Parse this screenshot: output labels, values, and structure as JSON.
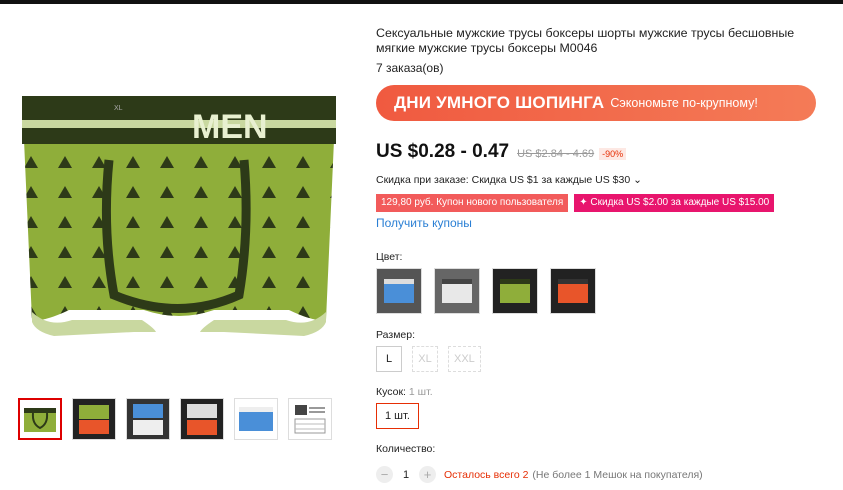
{
  "product": {
    "title": "Сексуальные мужские трусы боксеры шорты мужские трусы бесшовные мягкие мужские трусы боксеры M0046",
    "orders": "7 заказа(ов)"
  },
  "promo": {
    "main": "ДНИ УМНОГО ШОПИНГА",
    "sub": "Сэкономьте по-крупному!"
  },
  "pricing": {
    "price": "US $0.28 - 0.47",
    "old_price": "US $2.84 - 4.69",
    "discount": "-90%"
  },
  "store_discount": "Скидка при заказе: Скидка US $1 за каждые US $30 ⌄",
  "coupons": [
    "129,80 руб. Купон нового пользователя",
    "✦ Скидка US $2.00 за каждые US $15.00"
  ],
  "get_coupons": "Получить купоны",
  "color": {
    "label": "Цвет:",
    "options": [
      "blue",
      "white",
      "green",
      "orange"
    ]
  },
  "size": {
    "label": "Размер:",
    "options": [
      "L",
      "XL",
      "XXL"
    ]
  },
  "pieces": {
    "label": "Кусок:",
    "value": "1 шт.",
    "option": "1 шт."
  },
  "quantity": {
    "label": "Количество:",
    "value": "1",
    "minus_icon": "minus-icon",
    "plus_icon": "plus-icon",
    "left": "Осталось всего 2",
    "limit": "(Не более 1 Мешок на покупателя)"
  },
  "colors": {
    "accent": "#e62e04",
    "promo": "#f05a40",
    "coupon_red": "#f25b5b",
    "coupon_pink": "#e8156d",
    "link": "#2a7fd4",
    "product_green": "#8fae3a"
  },
  "gallery": {
    "thumbnail_count": 6,
    "active_index": 0
  }
}
